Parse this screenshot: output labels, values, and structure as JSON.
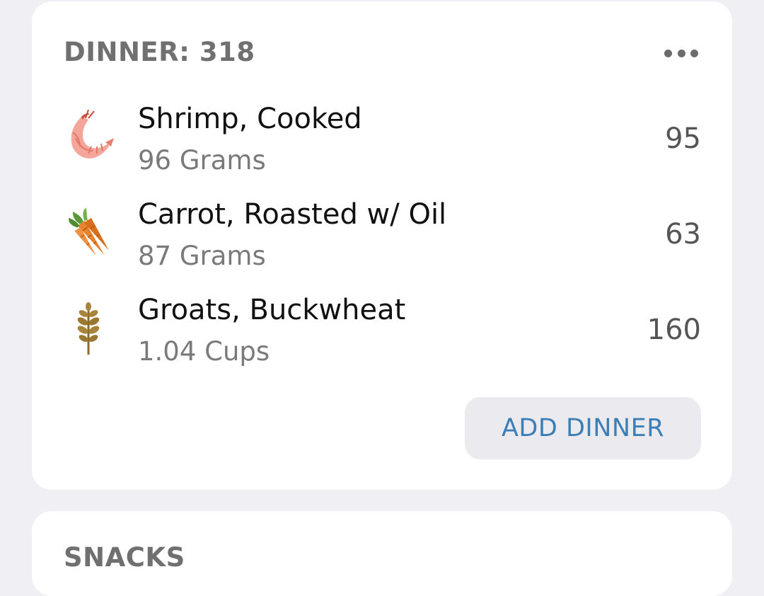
{
  "dinner": {
    "header": "DINNER: 318",
    "more_icon": "more-horizontal-icon",
    "items": [
      {
        "name": "Shrimp, Cooked",
        "amount": "96 Grams",
        "calories": "95",
        "icon": "shrimp-icon"
      },
      {
        "name": "Carrot, Roasted w/ Oil",
        "amount": "87 Grams",
        "calories": "63",
        "icon": "carrot-icon"
      },
      {
        "name": "Groats, Buckwheat",
        "amount": "1.04 Cups",
        "calories": "160",
        "icon": "wheat-icon"
      }
    ],
    "add_button_label": "ADD DINNER"
  },
  "snacks": {
    "header": "SNACKS"
  },
  "colors": {
    "background": "#efeff4",
    "card": "#ffffff",
    "header_text": "#707070",
    "accent": "#3b7fb6",
    "button_bg": "#ebebef"
  }
}
